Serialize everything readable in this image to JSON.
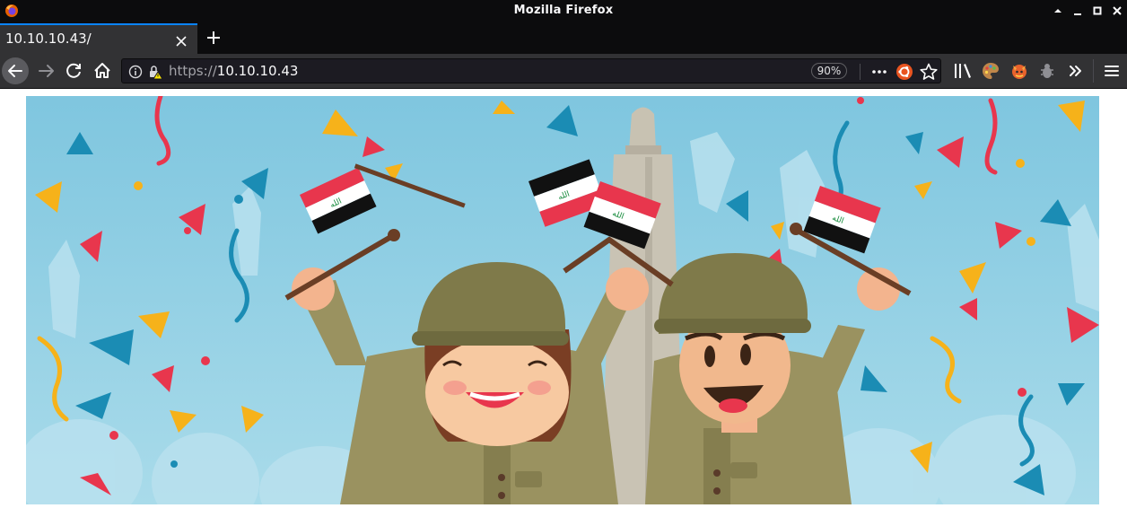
{
  "window": {
    "title": "Mozilla Firefox"
  },
  "tabs": [
    {
      "title": "10.10.10.43/",
      "active": true
    }
  ],
  "navbar": {
    "url_protocol": "https://",
    "url_host": "10.10.10.43",
    "zoom": "90%"
  },
  "icons": {
    "firefox": "firefox-logo-icon",
    "back": "back-arrow-icon",
    "forward": "forward-arrow-icon",
    "reload": "reload-icon",
    "home": "home-icon",
    "info": "info-icon",
    "lock": "insecure-lock-icon",
    "page_actions": "ellipsis-icon",
    "ubuntu": "ubuntu-icon",
    "bookmark": "star-icon",
    "library": "library-icon",
    "menu": "hamburger-menu-icon"
  },
  "colors": {
    "chrome_dark": "#0c0c0d",
    "toolbar": "#323234",
    "url_field": "#1c1b22",
    "tab_accent": "#0a84ff",
    "sky": "#8dcbe0"
  }
}
